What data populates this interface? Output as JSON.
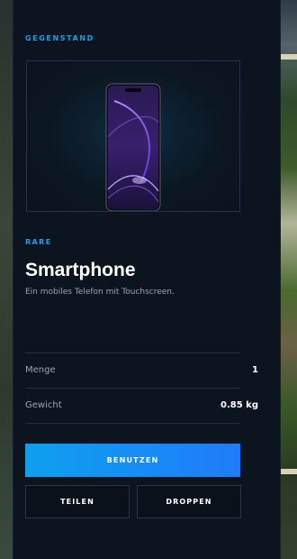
{
  "panel": {
    "section_label": "GEGENSTAND",
    "item": {
      "rarity": "RARE",
      "name": "Smartphone",
      "description": "Ein mobiles Telefon mit Touchscreen.",
      "image_icon": "smartphone-icon"
    },
    "stats": [
      {
        "label": "Menge",
        "value": "1"
      },
      {
        "label": "Gewicht",
        "value": "0.85 kg"
      }
    ],
    "actions": {
      "use": "BENUTZEN",
      "share": "TEILEN",
      "drop": "DROPPEN"
    }
  },
  "colors": {
    "accent": "#1aa0e8",
    "primary_button_start": "#0ea0ee",
    "primary_button_end": "#1f7bfb",
    "panel_background": "#0c1420",
    "muted_text": "#9aa6b4"
  }
}
